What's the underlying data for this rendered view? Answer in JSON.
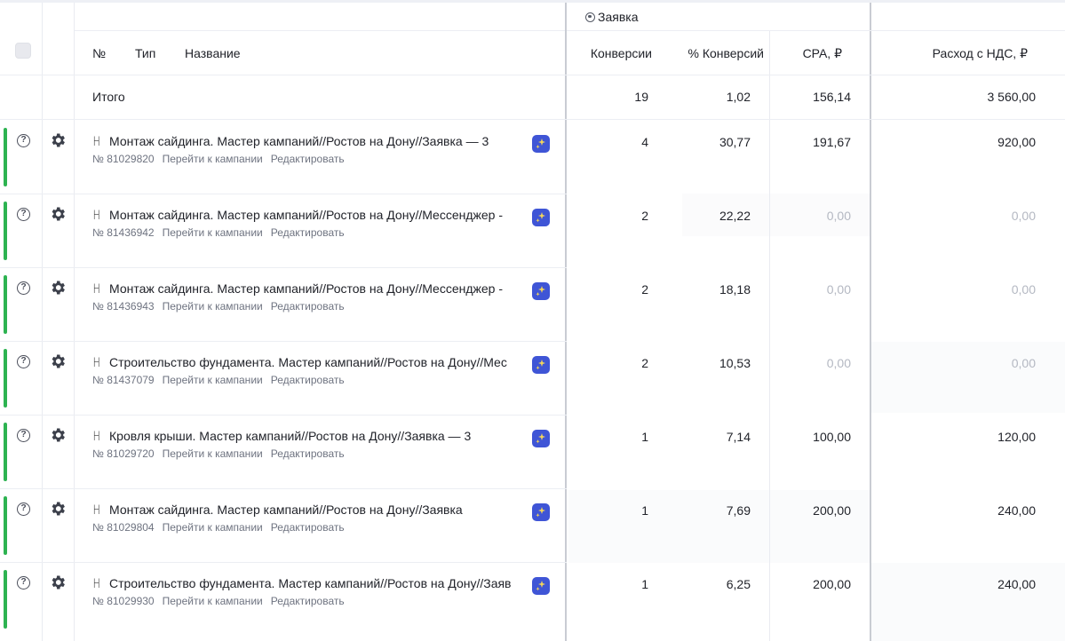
{
  "group_header": {
    "label": "Заявка",
    "icon": "target-icon"
  },
  "columns": {
    "number": "№",
    "type": "Тип",
    "name": "Название",
    "conversions": "Конверсии",
    "conversion_pct": "% Конверсий",
    "cpa": "CPA, ₽",
    "cost_vat": "Расход с НДС, ₽"
  },
  "totals": {
    "label": "Итого",
    "conversions": "19",
    "conversion_pct": "1,02",
    "cpa": "156,14",
    "cost_vat": "3 560,00"
  },
  "link_labels": {
    "go_to_campaign": "Перейти к кампании",
    "edit": "Редактировать"
  },
  "rows": [
    {
      "title": "Монтаж сайдинга. Мастер кампаний//Ростов на Дону//Заявка — 3",
      "id": "№ 81029820",
      "conversions": "4",
      "conversion_pct": "30,77",
      "cpa": "191,67",
      "cost_vat": "920,00"
    },
    {
      "title": "Монтаж сайдинга. Мастер кампаний//Ростов на Дону//Мессенджер - ",
      "id": "№ 81436942",
      "conversions": "2",
      "conversion_pct": "22,22",
      "cpa": "0,00",
      "cost_vat": "0,00"
    },
    {
      "title": "Монтаж сайдинга. Мастер кампаний//Ростов на Дону//Мессенджер - ",
      "id": "№ 81436943",
      "conversions": "2",
      "conversion_pct": "18,18",
      "cpa": "0,00",
      "cost_vat": "0,00"
    },
    {
      "title": "Строительство фундамента. Мастер кампаний//Ростов на Дону//Мес",
      "id": "№ 81437079",
      "conversions": "2",
      "conversion_pct": "10,53",
      "cpa": "0,00",
      "cost_vat": "0,00"
    },
    {
      "title": "Кровля крыши. Мастер кампаний//Ростов на Дону//Заявка — 3",
      "id": "№ 81029720",
      "conversions": "1",
      "conversion_pct": "7,14",
      "cpa": "100,00",
      "cost_vat": "120,00"
    },
    {
      "title": "Монтаж сайдинга. Мастер кампаний//Ростов на Дону//Заявка",
      "id": "№ 81029804",
      "conversions": "1",
      "conversion_pct": "7,69",
      "cpa": "200,00",
      "cost_vat": "240,00"
    },
    {
      "title": "Строительство фундамента. Мастер кампаний//Ростов на Дону//Заяв",
      "id": "№ 81029930",
      "conversions": "1",
      "conversion_pct": "6,25",
      "cpa": "200,00",
      "cost_vat": "240,00"
    }
  ],
  "colors": {
    "accent_green": "#2db351",
    "badge_blue": "#3f55d6",
    "muted_zero": "#b4b8c2"
  }
}
